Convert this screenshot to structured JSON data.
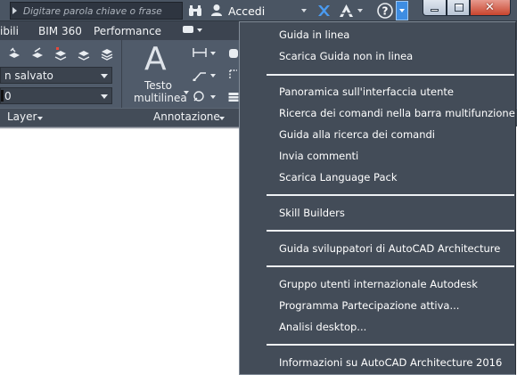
{
  "search": {
    "placeholder": "Digitare parola chiave o frase"
  },
  "account": {
    "signin_label": "Accedi"
  },
  "tabs": [
    {
      "label": "ibili"
    },
    {
      "label": "BIM 360"
    },
    {
      "label": "Performance"
    }
  ],
  "layer_panel": {
    "state_value": "n salvato",
    "layer_value": "0",
    "title": "Layer"
  },
  "annotation_panel": {
    "multitext_line1": "Testo",
    "multitext_line2": "multilinea",
    "title": "Annotazione"
  },
  "help_menu": {
    "groups": [
      [
        "Guida in linea",
        "Scarica Guida non in linea"
      ],
      [
        "Panoramica sull'interfaccia utente",
        "Ricerca dei comandi nella barra multifunzione",
        "Guida alla ricerca dei comandi",
        "Invia commenti",
        "Scarica Language Pack"
      ],
      [
        "Skill Builders"
      ],
      [
        "Guida sviluppatori di AutoCAD Architecture"
      ],
      [
        "Gruppo utenti internazionale Autodesk",
        "Programma Partecipazione attiva...",
        "Analisi desktop..."
      ],
      [
        "Informazioni su AutoCAD Architecture 2016"
      ]
    ]
  },
  "colors": {
    "titlebar": "#4a5563",
    "ribbon": "#505b6a",
    "menu_bg": "#434c58",
    "help_highlight": "#3e8de2",
    "close_button": "#c8442d"
  }
}
